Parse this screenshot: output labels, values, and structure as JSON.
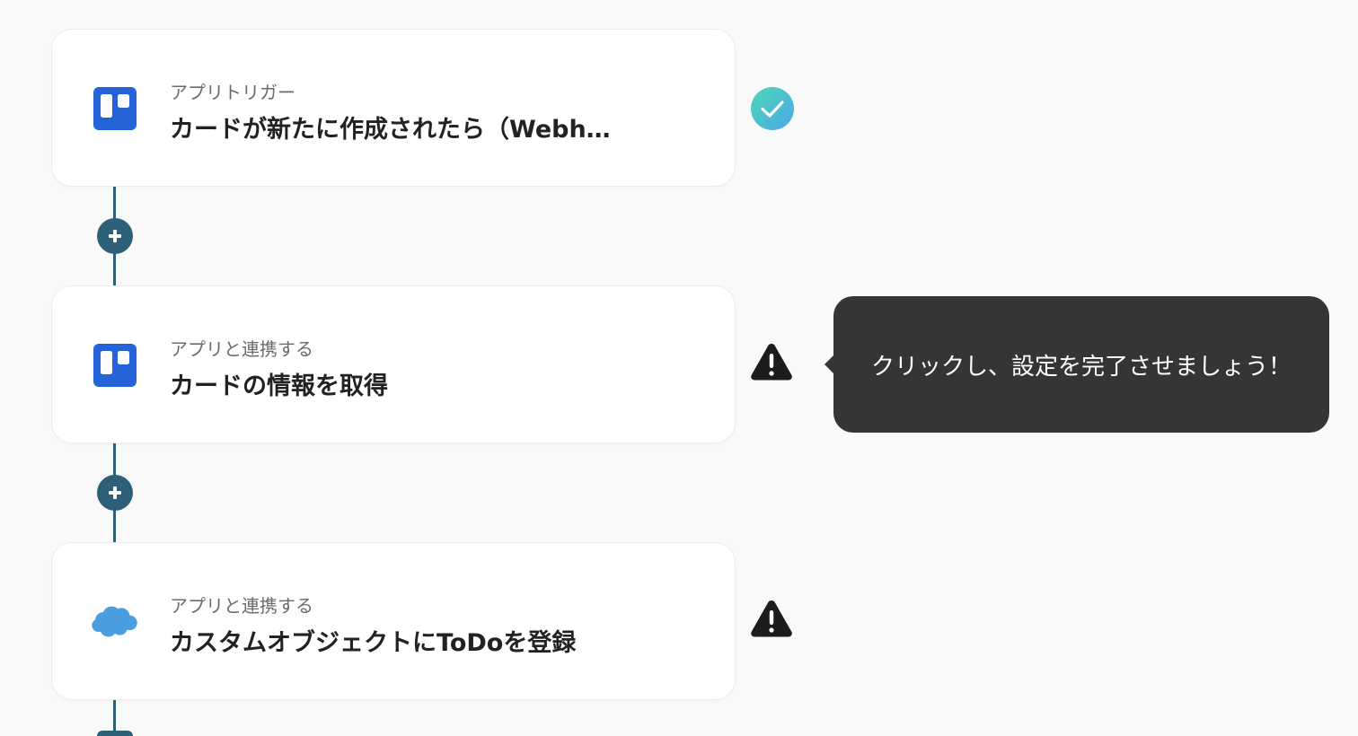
{
  "steps": [
    {
      "kind": "アプリトリガー",
      "title": "カードが新たに作成されたら（Webh…",
      "app_icon": "trello-icon",
      "status": "complete"
    },
    {
      "kind": "アプリと連携する",
      "title": "カードの情報を取得",
      "app_icon": "trello-icon",
      "status": "warning"
    },
    {
      "kind": "アプリと連携する",
      "title": "カスタムオブジェクトにToDoを登録",
      "app_icon": "salesforce-icon",
      "status": "warning"
    }
  ],
  "tooltip": {
    "text": "クリックし、設定を完了させましょう！"
  },
  "colors": {
    "background": "#f9f9f9",
    "connector": "#2e5f78",
    "trello_blue": "#2563d9",
    "salesforce_blue": "#4a9ee0",
    "check_gradient_start": "#4fd8b8",
    "check_gradient_end": "#4aa8e8",
    "warning": "#1c1c1c",
    "tooltip_bg": "#353535"
  }
}
